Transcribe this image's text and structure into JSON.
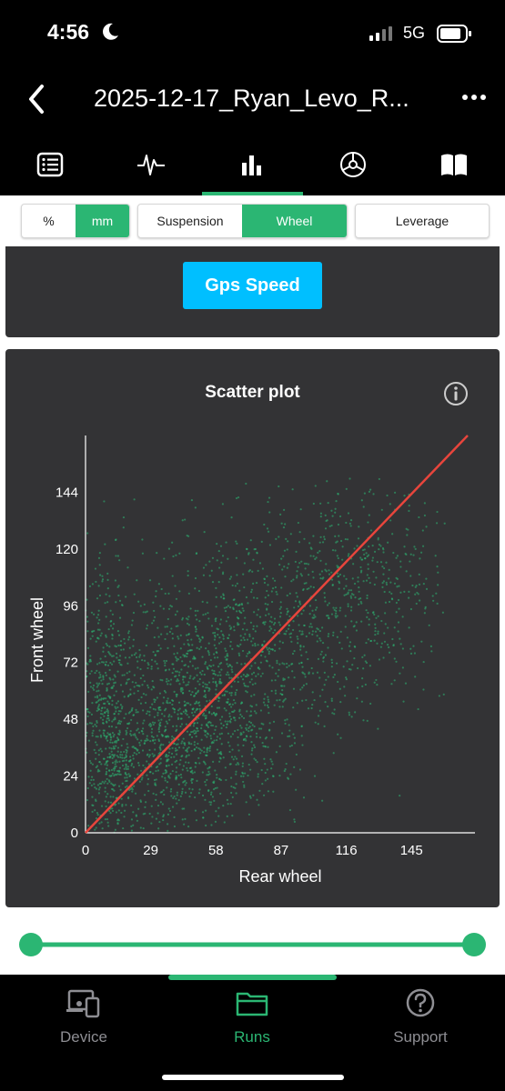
{
  "status_bar": {
    "time": "4:56",
    "network": "5G"
  },
  "header": {
    "title": "2025-12-17_Ryan_Levo_R..."
  },
  "tabs": [
    {
      "icon": "list-icon"
    },
    {
      "icon": "pulse-icon"
    },
    {
      "icon": "bar-chart-icon",
      "active": true
    },
    {
      "icon": "gear-wheel-icon"
    },
    {
      "icon": "book-icon"
    }
  ],
  "units": {
    "percent": "%",
    "mm": "mm",
    "selected": "mm"
  },
  "view": {
    "suspension": "Suspension",
    "wheel": "Wheel",
    "selected": "Wheel"
  },
  "leverage": {
    "label": "Leverage"
  },
  "gps_card": {
    "button": "Gps Speed"
  },
  "chart_data": {
    "type": "scatter",
    "title": "Scatter plot",
    "xlabel": "Rear wheel",
    "ylabel": "Front wheel",
    "x_ticks": [
      0,
      29,
      58,
      87,
      116,
      145
    ],
    "y_ticks": [
      0,
      24,
      48,
      72,
      96,
      120,
      144
    ],
    "xlim": [
      0,
      170
    ],
    "ylim": [
      0,
      168
    ],
    "grid": false,
    "colors": {
      "points": "#2bb673",
      "reference": "#e8453c"
    },
    "series": [
      {
        "type": "reference_line",
        "x": [
          0,
          170
        ],
        "y": [
          0,
          168
        ]
      },
      {
        "type": "scatter_density",
        "clusters": [
          {
            "cx": 35,
            "cy": 30,
            "sx": 18,
            "sy": 16
          },
          {
            "cx": 55,
            "cy": 55,
            "sx": 25,
            "sy": 23
          },
          {
            "cx": 70,
            "cy": 88,
            "sx": 30,
            "sy": 24
          },
          {
            "cx": 10,
            "cy": 45,
            "sx": 6,
            "sy": 35
          },
          {
            "cx": 120,
            "cy": 105,
            "sx": 22,
            "sy": 22
          }
        ]
      }
    ]
  },
  "slider": {
    "min": 0,
    "max": 1,
    "start": 0,
    "end": 1
  },
  "bottom_nav": [
    {
      "label": "Device",
      "icon": "device-icon",
      "active": false
    },
    {
      "label": "Runs",
      "icon": "folder-icon",
      "active": true
    },
    {
      "label": "Support",
      "icon": "help-icon",
      "active": false
    }
  ],
  "accent": "#2bb673"
}
